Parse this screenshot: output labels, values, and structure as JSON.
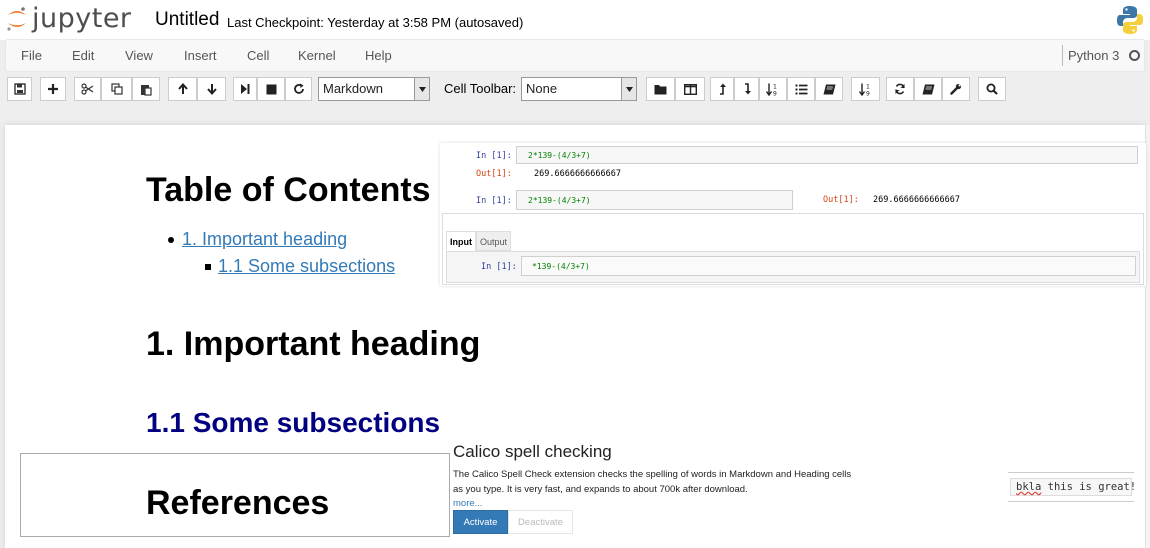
{
  "header": {
    "logo_text": "jupyter",
    "notebook_title": "Untitled",
    "checkpoint": "Last Checkpoint: Yesterday at 3:58 PM (autosaved)"
  },
  "menubar": {
    "items": [
      "File",
      "Edit",
      "View",
      "Insert",
      "Cell",
      "Kernel",
      "Help"
    ],
    "kernel_name": "Python 3"
  },
  "toolbar": {
    "cell_type": "Markdown",
    "cell_toolbar_label": "Cell Toolbar:",
    "cell_toolbar_value": "None"
  },
  "notebook": {
    "toc_title": "Table of Contents",
    "toc_items": [
      {
        "label": "1. Important heading"
      },
      {
        "label": "1.1 Some subsections"
      }
    ],
    "heading1": "1. Important heading",
    "heading2": "1.1 Some subsections",
    "references": "References"
  },
  "overlay_cells": {
    "in_prompt": "In [1]:",
    "out_prompt": "Out[1]:",
    "code": "2*139-(4/3+7)",
    "output": "269.6666666666667",
    "tabs": [
      "Input",
      "Output"
    ],
    "code_partial": "*139-(4/3+7)"
  },
  "calico": {
    "title": "Calico spell checking",
    "desc_line1": "The Calico Spell Check extension checks the spelling of words in Markdown and Heading cells",
    "desc_line2": "as you type. It is very fast, and expands to about 700k after download.",
    "more": "more...",
    "activate": "Activate",
    "deactivate": "Deactivate",
    "demo_bad_word": "bkla",
    "demo_rest": " this is great!"
  },
  "colors": {
    "link": "#337ab7",
    "heading2": "#000080",
    "in_prompt": "#303f9f",
    "out_prompt": "#d84315",
    "jupyter_orange": "#f37726"
  }
}
